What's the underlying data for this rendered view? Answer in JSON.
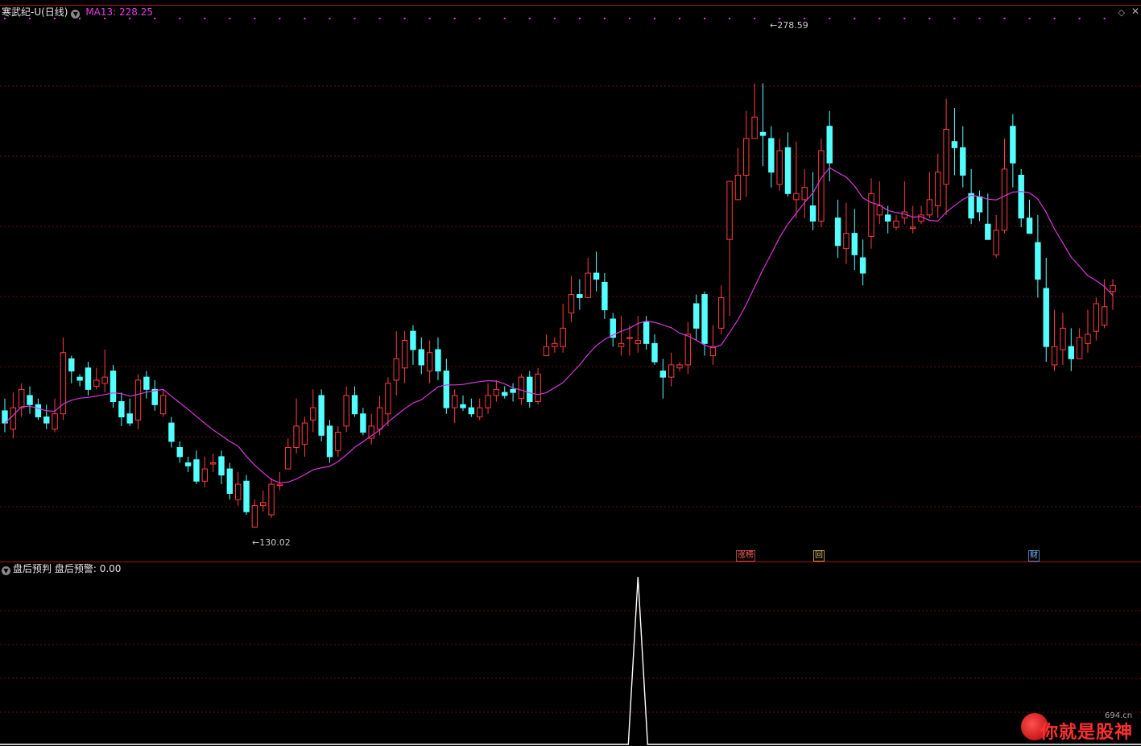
{
  "header": {
    "stock_title": "寒武纪-U(日线)",
    "ma_label": "MA13: 228.25",
    "diamond_icon": "diamond-icon",
    "close_icon": "close-icon"
  },
  "indicator": {
    "title": "盘后预判",
    "value_label": "盘后预警: 0.00"
  },
  "badges": {
    "limit_up": "涨榜",
    "hui": "回",
    "cai": "财"
  },
  "price_labels": {
    "high": "278.59",
    "low": "130.02"
  },
  "logo": {
    "text": "你就是股神",
    "url": "694.cn"
  },
  "colors": {
    "up": "#ff3c3c",
    "down": "#54ffff",
    "ma": "#d838d8",
    "grid": "#6a1010",
    "indicator_line": "#ffffff"
  },
  "chart_data": {
    "type": "candlestick",
    "ylim": [
      118,
      296
    ],
    "ma_period": 13,
    "signal_index": 76,
    "indicator_values_note": "",
    "candles": [
      [
        167,
        163,
        171,
        160
      ],
      [
        161,
        168,
        173,
        158
      ],
      [
        168,
        174,
        176,
        165
      ],
      [
        172,
        169,
        175,
        166
      ],
      [
        169,
        165,
        171,
        164
      ],
      [
        165,
        163,
        169,
        161
      ],
      [
        161,
        166,
        171,
        160
      ],
      [
        166,
        186,
        191,
        164
      ],
      [
        184,
        180,
        185,
        176
      ],
      [
        178,
        177,
        179,
        175
      ],
      [
        181,
        174,
        183,
        172
      ],
      [
        175,
        177,
        181,
        174
      ],
      [
        176,
        178,
        187,
        173
      ],
      [
        180,
        170,
        182,
        168
      ],
      [
        170,
        165,
        173,
        162
      ],
      [
        166,
        163,
        171,
        162
      ],
      [
        164,
        177,
        179,
        161
      ],
      [
        178,
        174,
        180,
        171
      ],
      [
        174,
        169,
        177,
        167
      ],
      [
        166,
        172,
        174,
        165
      ],
      [
        163,
        157,
        165,
        155
      ],
      [
        155,
        152,
        157,
        150
      ],
      [
        150,
        149,
        152,
        147
      ],
      [
        151,
        144,
        154,
        143
      ],
      [
        144,
        148,
        152,
        142
      ],
      [
        150,
        150,
        153,
        147
      ],
      [
        152,
        146,
        154,
        143
      ],
      [
        148,
        140,
        150,
        138
      ],
      [
        138,
        143,
        147,
        136
      ],
      [
        144,
        134,
        146,
        133
      ],
      [
        129,
        136,
        138,
        130
      ],
      [
        136,
        137,
        141,
        134
      ],
      [
        133,
        143,
        145,
        132
      ],
      [
        143,
        143,
        147,
        141
      ],
      [
        148,
        155,
        158,
        148
      ],
      [
        155,
        162,
        171,
        153
      ],
      [
        156,
        163,
        165,
        152
      ],
      [
        164,
        168,
        174,
        160
      ],
      [
        172,
        159,
        174,
        157
      ],
      [
        162,
        152,
        164,
        150
      ],
      [
        154,
        160,
        162,
        152
      ],
      [
        162,
        172,
        175,
        160
      ],
      [
        172,
        166,
        175,
        165
      ],
      [
        166,
        160,
        168,
        159
      ],
      [
        158,
        162,
        166,
        156
      ],
      [
        161,
        168,
        172,
        159
      ],
      [
        166,
        176,
        178,
        162
      ],
      [
        177,
        184,
        193,
        172
      ],
      [
        181,
        190,
        193,
        176
      ],
      [
        193,
        187,
        195,
        182
      ],
      [
        187,
        182,
        191,
        179
      ],
      [
        180,
        186,
        190,
        176
      ],
      [
        187,
        180,
        191,
        177
      ],
      [
        180,
        168,
        184,
        166
      ],
      [
        168,
        172,
        174,
        163
      ],
      [
        169,
        168,
        172,
        167
      ],
      [
        168,
        166,
        171,
        165
      ],
      [
        165,
        168,
        171,
        164
      ],
      [
        168,
        172,
        176,
        166
      ],
      [
        172,
        174,
        177,
        170
      ],
      [
        173,
        172,
        175,
        171
      ],
      [
        174,
        173,
        176,
        170
      ],
      [
        171,
        178,
        179,
        169
      ],
      [
        178,
        170,
        180,
        168
      ],
      [
        170,
        179,
        181,
        169
      ],
      [
        185,
        188,
        192,
        185
      ],
      [
        188,
        189,
        191,
        186
      ],
      [
        188,
        194,
        202,
        186
      ],
      [
        199,
        205,
        211,
        196
      ],
      [
        205,
        204,
        210,
        200
      ],
      [
        204,
        212,
        217,
        208
      ],
      [
        212,
        210,
        219,
        206
      ],
      [
        209,
        200,
        212,
        197
      ],
      [
        197,
        191,
        199,
        188
      ],
      [
        188,
        189,
        198,
        185
      ],
      [
        191,
        191,
        195,
        185
      ],
      [
        189,
        190,
        198,
        186
      ],
      [
        196,
        189,
        198,
        187
      ],
      [
        189,
        183,
        192,
        182
      ],
      [
        180,
        178,
        184,
        171
      ],
      [
        178,
        182,
        186,
        175
      ],
      [
        181,
        182,
        183,
        180
      ],
      [
        182,
        192,
        196,
        179
      ],
      [
        202,
        194,
        205,
        190
      ],
      [
        205,
        189,
        206,
        185
      ],
      [
        185,
        188,
        195,
        182
      ],
      [
        194,
        204,
        208,
        192
      ],
      [
        223,
        242,
        242,
        198
      ],
      [
        236,
        244,
        253,
        236
      ],
      [
        244,
        256,
        265,
        237
      ],
      [
        256,
        263,
        274,
        256
      ],
      [
        258,
        257,
        274,
        247
      ],
      [
        256,
        245,
        260,
        240
      ],
      [
        241,
        252,
        256,
        239
      ],
      [
        253,
        238,
        258,
        237
      ],
      [
        236,
        238,
        255,
        230
      ],
      [
        236,
        240,
        246,
        230
      ],
      [
        234,
        229,
        245,
        226
      ],
      [
        229,
        252,
        256,
        227
      ],
      [
        260,
        248,
        265,
        242
      ],
      [
        230,
        221,
        236,
        217
      ],
      [
        220,
        225,
        235,
        215
      ],
      [
        225,
        218,
        233,
        213
      ],
      [
        217,
        212,
        223,
        208
      ],
      [
        224,
        238,
        243,
        220
      ],
      [
        231,
        234,
        242,
        228
      ],
      [
        231,
        229,
        234,
        225
      ],
      [
        227,
        229,
        231,
        226
      ],
      [
        230,
        232,
        242,
        228
      ],
      [
        227,
        227,
        234,
        225
      ],
      [
        229,
        231,
        234,
        228
      ],
      [
        231,
        236,
        245,
        230
      ],
      [
        234,
        245,
        251,
        230
      ],
      [
        241,
        259,
        269,
        231
      ],
      [
        255,
        253,
        266,
        244
      ],
      [
        253,
        244,
        260,
        240
      ],
      [
        238,
        230,
        246,
        228
      ],
      [
        237,
        232,
        239,
        229
      ],
      [
        228,
        223,
        238,
        225
      ],
      [
        218,
        226,
        231,
        217
      ],
      [
        226,
        246,
        256,
        225
      ],
      [
        260,
        248,
        264,
        240
      ],
      [
        244,
        230,
        246,
        227
      ],
      [
        230,
        225,
        236,
        225
      ],
      [
        222,
        210,
        231,
        204
      ],
      [
        207,
        188,
        217,
        183
      ],
      [
        182,
        188,
        200,
        180
      ],
      [
        187,
        194,
        199,
        182
      ],
      [
        188,
        184,
        194,
        180
      ],
      [
        184,
        191,
        194,
        188
      ],
      [
        189,
        192,
        200,
        186
      ],
      [
        193,
        202,
        204,
        190
      ],
      [
        195,
        201,
        210,
        194
      ],
      [
        206,
        208,
        210,
        200
      ]
    ]
  }
}
